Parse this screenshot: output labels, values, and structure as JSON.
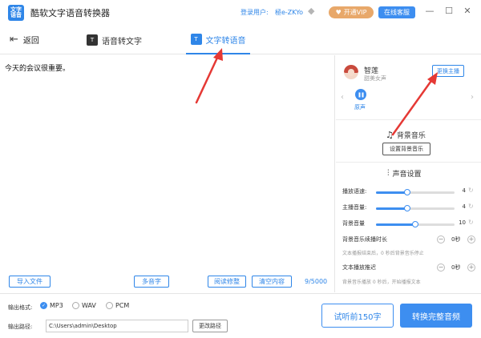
{
  "titlebar": {
    "logo_text": "文字\n语音",
    "title": "酷软文字语音转换器",
    "login_label": "登录用户:",
    "login_user": "極e-ZKYo",
    "vip_label": "开通VIP",
    "service_label": "在线客服",
    "min_glyph": "—",
    "max_glyph": "☐",
    "close_glyph": "✕"
  },
  "tabs": {
    "back_label": "返回",
    "speech_to_text": "语音转文字",
    "text_to_speech": "文字转语音"
  },
  "editor": {
    "text": "今天的会议很重要。",
    "import_label": "导入文件",
    "polyphone_label": "多音字",
    "proofread_label": "阅读修整",
    "clear_label": "清空内容",
    "char_count": "9/5000"
  },
  "voice": {
    "name": "智莲",
    "desc": "甜美女声",
    "change_label": "更换主播",
    "original_label": "原声"
  },
  "bgm": {
    "title": "背景音乐",
    "set_label": "设置背景音乐"
  },
  "sound": {
    "title": "声音设置",
    "speed_label": "播放语速:",
    "speed_value": "4",
    "speed_fraction": 0.4,
    "volume_label": "主播音量:",
    "volume_value": "4",
    "volume_fraction": 0.4,
    "bg_volume_label": "背景音量",
    "bg_volume_value": "10",
    "bg_volume_fraction": 0.5,
    "bgm_delay_label": "背景音乐续播时长",
    "bgm_delay_value": "0秒",
    "bgm_delay_note": "文本播报结束后，0 秒后背景音乐停止",
    "text_delay_label": "文本播放推迟",
    "text_delay_value": "0秒",
    "text_delay_note": "背景音乐播放 0 秒后，开始播报文本"
  },
  "output": {
    "format_label": "输出格式:",
    "formats": [
      "MP3",
      "WAV",
      "PCM"
    ],
    "selected_format": "MP3",
    "path_label": "输出路径:",
    "path_value": "C:\\Users\\admin\\Desktop",
    "change_path_label": "更改路径",
    "preview_label": "试听前150字",
    "convert_label": "转换完整音频"
  },
  "colors": {
    "accent": "#2f86e8",
    "vip": "#e8a86a",
    "arrow": "#e53935"
  }
}
